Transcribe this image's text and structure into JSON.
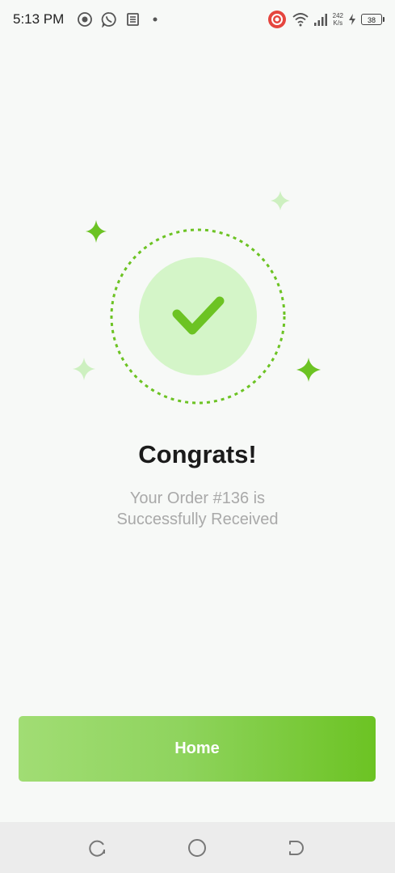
{
  "status_bar": {
    "time": "5:13 PM",
    "net_speed_value": "242",
    "net_speed_unit": "K/s",
    "battery": "38",
    "icons": [
      "screen-record-icon",
      "whatsapp-icon",
      "news-icon",
      "dot-icon",
      "record-badge-icon",
      "wifi-icon",
      "signal-icon",
      "charging-icon"
    ]
  },
  "success": {
    "title": "Congrats!",
    "message_line1": "Your Order #136 is",
    "message_line2": "Successfully Received"
  },
  "actions": {
    "home_label": "Home"
  },
  "colors": {
    "accent": "#6cc323",
    "accent_light": "#a1dd74",
    "check_bg": "#d4f5c8",
    "background": "#f7f9f7"
  },
  "nav_bar": {
    "icons": [
      "recent-apps-icon",
      "home-nav-icon",
      "back-icon"
    ]
  }
}
